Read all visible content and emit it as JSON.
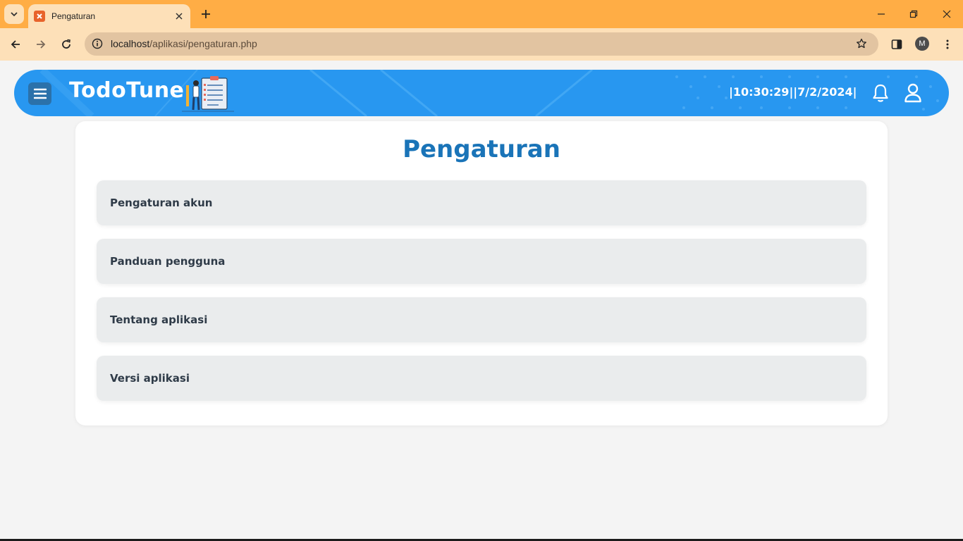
{
  "browser": {
    "tab_title": "Pengaturan",
    "url_host": "localhost",
    "url_path": "/aplikasi/pengaturan.php",
    "profile_initial": "M"
  },
  "header": {
    "brand": "TodoTune",
    "clock": "|10:30:29||7/2/2024|",
    "accent": "#2897f0"
  },
  "settings": {
    "title": "Pengaturan",
    "title_color": "#1a74b8",
    "items": [
      {
        "label": "Pengaturan akun"
      },
      {
        "label": "Panduan pengguna"
      },
      {
        "label": "Tentang aplikasi"
      },
      {
        "label": "Versi aplikasi"
      }
    ]
  },
  "icons": {
    "menu": "hamburger-icon",
    "notifications": "bell-icon",
    "profile": "user-icon"
  }
}
